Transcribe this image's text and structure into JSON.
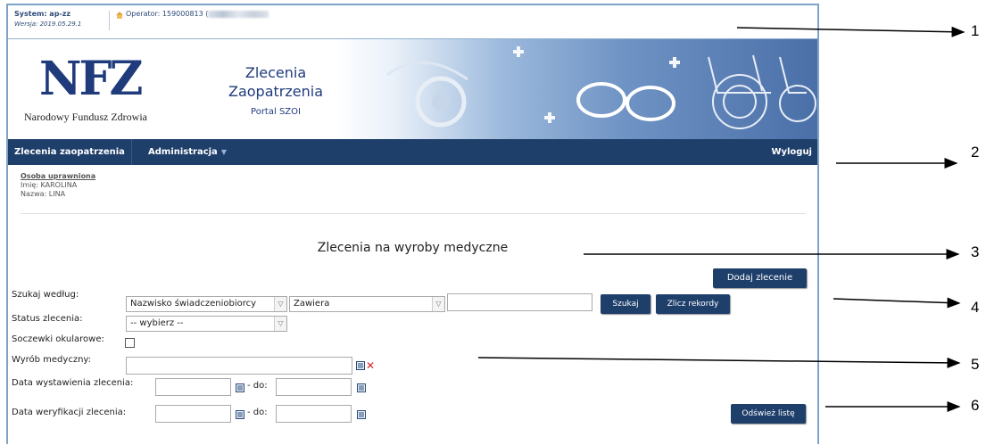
{
  "system": {
    "label": "System: ap-zz",
    "version": "Wersja: 2019.05.29.1",
    "operator_prefix": "Operator: 159000813 ("
  },
  "banner": {
    "logo": "NFZ",
    "logo_subtitle": "Narodowy Fundusz Zdrowia",
    "title_line1": "Zlecenia",
    "title_line2": "Zaopatrzenia",
    "subtitle": "Portal SZOI"
  },
  "nav": {
    "item1": "Zlecenia zaopatrzenia",
    "item2": "Administracja",
    "logout": "Wyloguj"
  },
  "person": {
    "title": "Osoba uprawniona",
    "first_name": "Imię: KAROLINA",
    "last_name": "Nazwa: LINA"
  },
  "page": {
    "title": "Zlecenia na wyroby medyczne",
    "add_button": "Dodaj zlecenie"
  },
  "search": {
    "label": "Szukaj według:",
    "field_select": "Nazwisko świadczeniobiorcy",
    "operator_select": "Zawiera",
    "value": "",
    "search_button": "Szukaj",
    "count_button": "Zlicz rekordy"
  },
  "filters": {
    "status_label": "Status zlecenia:",
    "status_select": "-- wybierz --",
    "lenses_label": "Soczewki okularowe:",
    "device_label": "Wyrób medyczny:",
    "issue_date_label": "Data wystawienia zlecenia:",
    "verify_date_label": "Data weryfikacji zlecenia:",
    "to_label": "- do:"
  },
  "refresh_button": "Odśwież listę",
  "callouts": [
    "1",
    "2",
    "3",
    "4",
    "5",
    "6"
  ],
  "colors": {
    "nav_bg": "#1f3f6b",
    "brand_blue": "#1f3b7c",
    "clear_red": "#d62020"
  }
}
